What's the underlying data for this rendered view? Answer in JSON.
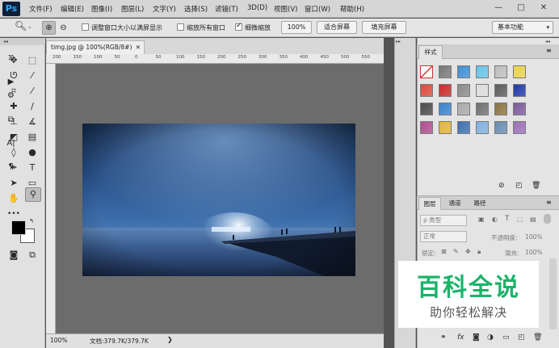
{
  "app": {
    "logo": "Ps"
  },
  "menu": [
    "文件(F)",
    "编辑(E)",
    "图像(I)",
    "图层(L)",
    "文字(Y)",
    "选择(S)",
    "滤镜(T)",
    "3D(D)",
    "视图(V)",
    "窗口(W)",
    "帮助(H)"
  ],
  "window_controls": {
    "minimize": "—",
    "restore": "□",
    "close": "✕"
  },
  "options": {
    "resize_windows_label": "调整窗口大小以满屏显示",
    "zoom_all_label": "缩放所有窗口",
    "scrubby_zoom_label": "细微缩放",
    "zoom_value": "100%",
    "fit_screen": "适合屏幕",
    "fill_screen": "填充屏幕",
    "workspace": "基本功能"
  },
  "document": {
    "tab_title": "timg.jpg @ 100%(RGB/8#)",
    "zoom_status": "100%",
    "doc_size": "文档:379.7K/379.7K"
  },
  "ruler_top": [
    "200",
    "150",
    "100",
    "50",
    "0",
    "50",
    "100",
    "150",
    "200",
    "250",
    "300",
    "350",
    "400",
    "450",
    "500",
    "550"
  ],
  "styles_panel": {
    "tab": "样式"
  },
  "style_swatches": [
    "#ffffff",
    "#777777",
    "#3d8fd6",
    "#66c3e8",
    "#bdbdbd",
    "#e8d24a",
    "#d84b3c",
    "#c92b2b",
    "#8a8a8a",
    "#dcdcdc",
    "#5b5b5b",
    "#1f3aa8",
    "#4a4a4a",
    "#3c82c9",
    "#a9a9a9",
    "#6f6f6f",
    "#8a7442",
    "#7c5b9a",
    "#b04d8e",
    "#e0b43a",
    "#3d6fb0",
    "#7fb0e0",
    "#6a8caf",
    "#9c6fb8"
  ],
  "layers_panel": {
    "tabs": [
      "图层",
      "通道",
      "路径"
    ],
    "kind_filter": "ρ 类型",
    "blend_mode": "正常",
    "opacity_label": "不透明度:",
    "opacity_value": "100%",
    "lock_label": "锁定:",
    "fill_label": "填充:",
    "fill_value": "100%"
  },
  "watermark": {
    "title": "百科全说",
    "subtitle": "助你轻松解决"
  }
}
